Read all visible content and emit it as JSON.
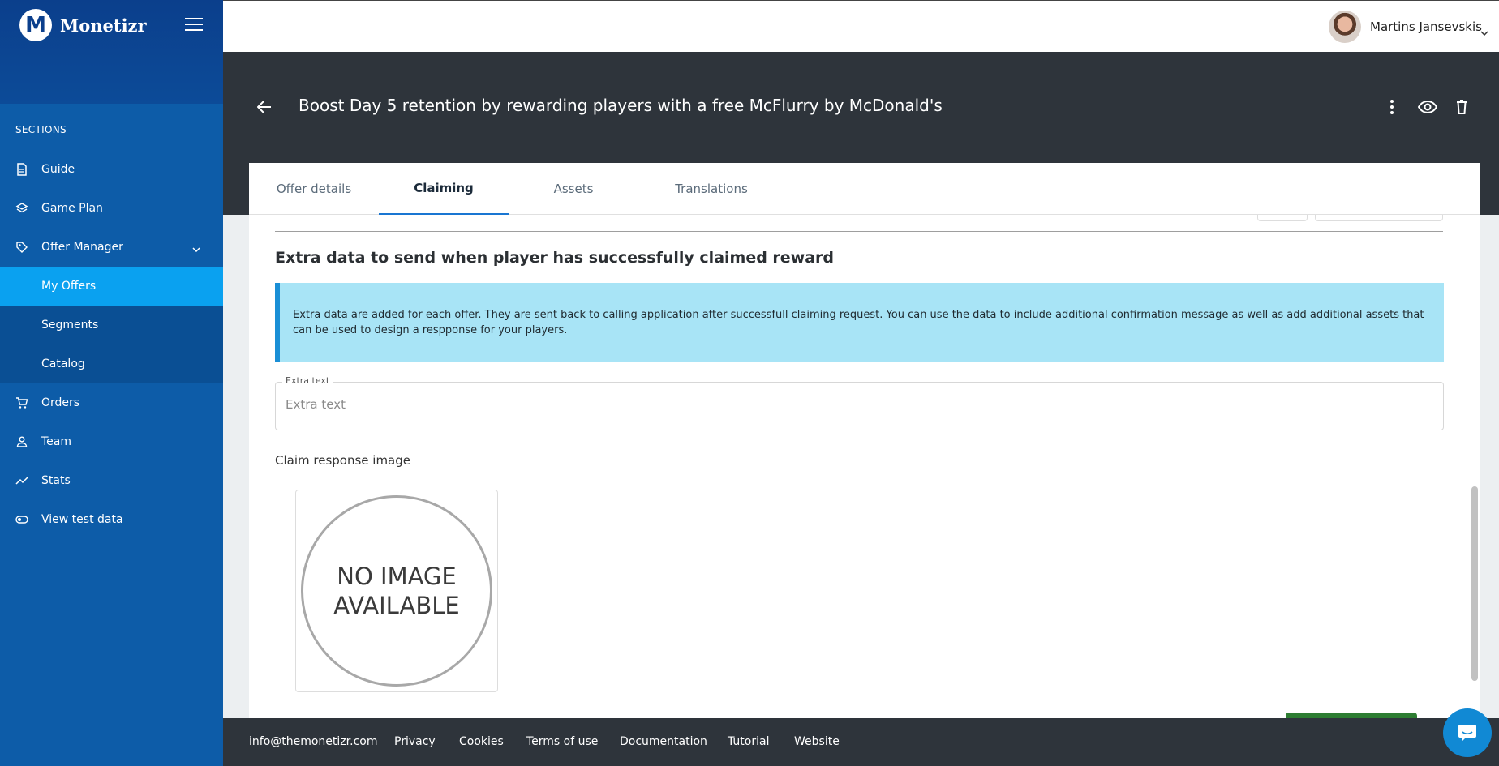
{
  "sidebar": {
    "logo_letter": "M",
    "logo_text": "Monetizr",
    "sections_label": "SECTIONS",
    "items": [
      {
        "label": "Guide",
        "icon": "document-icon"
      },
      {
        "label": "Game Plan",
        "icon": "layers-icon"
      },
      {
        "label": "Offer Manager",
        "icon": "tag-icon"
      },
      {
        "label": "Orders",
        "icon": "cart-icon"
      },
      {
        "label": "Team",
        "icon": "person-icon"
      },
      {
        "label": "Stats",
        "icon": "trend-icon"
      },
      {
        "label": "View test data",
        "icon": "toggle-icon"
      }
    ],
    "sub_items": [
      {
        "label": "My Offers",
        "active": true
      },
      {
        "label": "Segments",
        "active": false
      },
      {
        "label": "Catalog",
        "active": false
      }
    ]
  },
  "header": {
    "username": "Martins Jansevskis"
  },
  "hero": {
    "title": "Boost Day 5 retention by rewarding players with a free McFlurry by McDonald's"
  },
  "tabs": [
    {
      "label": "Offer details",
      "active": false
    },
    {
      "label": "Claiming",
      "active": true
    },
    {
      "label": "Assets",
      "active": false
    },
    {
      "label": "Translations",
      "active": false
    }
  ],
  "content": {
    "section_title": "Extra data to send when player has successfully claimed reward",
    "info_text": "Extra data are added for each offer. They are sent back to calling application after successfull claiming request. You can use the data to include additional confirmation message as well as add additional assets that can be used to design a respponse for your players.",
    "extra_text_label": "Extra text",
    "extra_text_placeholder": "Extra text",
    "extra_text_value": "",
    "claim_image_label": "Claim response image",
    "no_image_line1": "NO IMAGE",
    "no_image_line2": "AVAILABLE"
  },
  "footer": {
    "links": [
      "info@themonetizr.com",
      "Privacy",
      "Cookies",
      "Terms of use",
      "Documentation",
      "Tutorial",
      "Website"
    ]
  },
  "colors": {
    "sidebar": "#0d5ca8",
    "sidebar_top": "#0b3f8c",
    "active_item": "#0aa1f0",
    "hero": "#2e343b",
    "info_box": "#a8e4f6",
    "info_border": "#1a8fd6",
    "primary_green": "#2e7d32"
  }
}
